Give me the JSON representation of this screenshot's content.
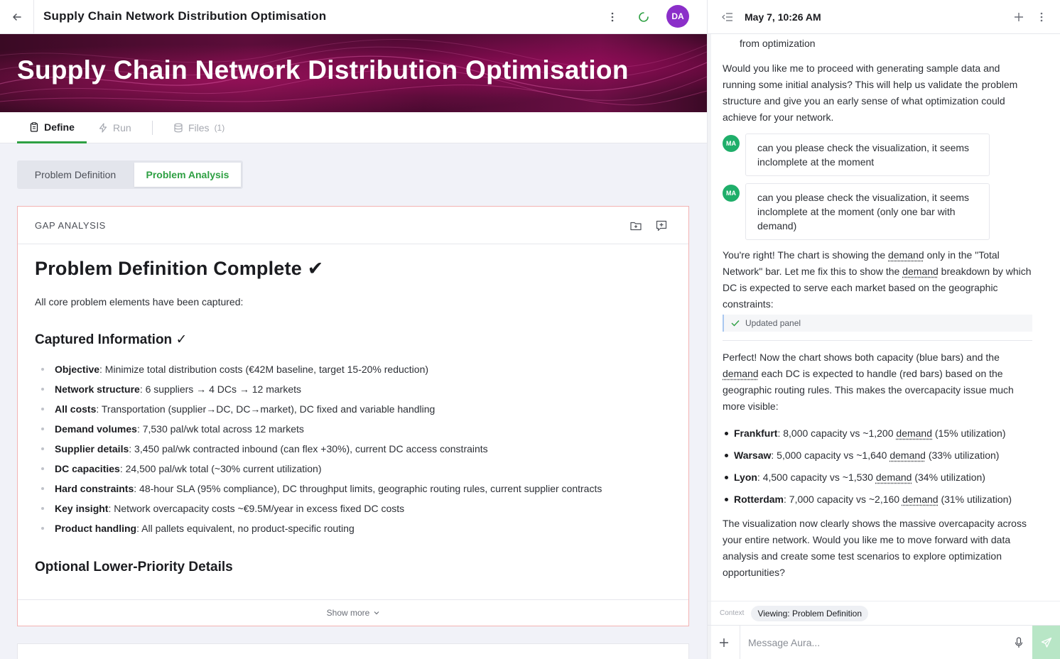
{
  "app": {
    "title": "Supply Chain Network Distribution Optimisation",
    "avatar_initials": "DA",
    "accent": "#2ea043",
    "avatar_color": "#8b2fc9"
  },
  "banner": {
    "title": "Supply Chain Network Distribution Optimisation"
  },
  "tabs": {
    "define": "Define",
    "run": "Run",
    "files": "Files",
    "files_count": "(1)"
  },
  "segmented": {
    "definition": "Problem Definition",
    "analysis": "Problem Analysis"
  },
  "card": {
    "label": "GAP ANALYSIS",
    "heading": "Problem Definition Complete ✔",
    "intro": "All core problem elements have been captured:",
    "captured_heading": "Captured Information ✓",
    "items": [
      {
        "key": "Objective",
        "text": ": Minimize total distribution costs (€42M baseline, target 15-20% reduction)"
      },
      {
        "key": "Network structure",
        "text": ": 6 suppliers → 4 DCs → 12 markets"
      },
      {
        "key": "All costs",
        "text": ": Transportation (supplier→DC, DC→market), DC fixed and variable handling"
      },
      {
        "key": "Demand volumes",
        "text": ": 7,530 pal/wk total across 12 markets"
      },
      {
        "key": "Supplier details",
        "text": ": 3,450 pal/wk contracted inbound (can flex +30%), current DC access constraints"
      },
      {
        "key": "DC capacities",
        "text": ": 24,500 pal/wk total (~30% current utilization)"
      },
      {
        "key": "Hard constraints",
        "text": ": 48-hour SLA (95% compliance), DC throughput limits, geographic routing rules, current supplier contracts"
      },
      {
        "key": "Key insight",
        "text": ": Network overcapacity costs ~€9.5M/year in excess fixed DC costs"
      },
      {
        "key": "Product handling",
        "text": ": All pallets equivalent, no product-specific routing"
      }
    ],
    "optional_heading": "Optional Lower-Priority Details",
    "show_more": "Show more"
  },
  "chat": {
    "timestamp": "May 7, 10:26 AM",
    "fragment": "from optimization",
    "msg1": "Would you like me to proceed with generating sample data and running some initial analysis? This will help us validate the problem structure and give you an early sense of what optimization could achieve for your network.",
    "user_initials": "MA",
    "user1": "can you please check the visualization, it seems inclomplete at the moment",
    "user2": "can you please check the visualization, it seems inclomplete at the moment (only one bar with demand)",
    "reply_a": "You're right! The chart is showing the ",
    "reply_b": "demand",
    "reply_c": " only in the \"Total Network\" bar. Let me fix this to show the ",
    "reply_d": "demand",
    "reply_e": " breakdown by which DC is expected to serve each market based on the geographic constraints:",
    "updated_panel": "Updated panel",
    "perfect_a": "Perfect! Now the chart shows both capacity (blue bars) and the ",
    "perfect_b": "demand",
    "perfect_c": " each DC is expected to handle (red bars) based on the geographic routing rules. This makes the overcapacity issue much more visible:",
    "bullets": [
      {
        "key": "Frankfurt",
        "pre": ": 8,000 capacity vs ~1,200 ",
        "dem": "demand",
        "post": " (15% utilization)"
      },
      {
        "key": "Warsaw",
        "pre": ": 5,000 capacity vs ~1,640 ",
        "dem": "demand",
        "post": " (33% utilization)"
      },
      {
        "key": "Lyon",
        "pre": ": 4,500 capacity vs ~1,530 ",
        "dem": "demand",
        "post": " (34% utilization)"
      },
      {
        "key": "Rotterdam",
        "pre": ": 7,000 capacity vs ~2,160 ",
        "dem": "demand",
        "post": " (31% utilization)"
      }
    ],
    "closing": "The visualization now clearly shows the massive overcapacity across your entire network. Would you like me to move forward with data analysis and create some test scenarios to explore optimization opportunities?",
    "context_label": "Context",
    "context_chip": "Viewing: Problem Definition",
    "input_placeholder": "Message Aura..."
  }
}
